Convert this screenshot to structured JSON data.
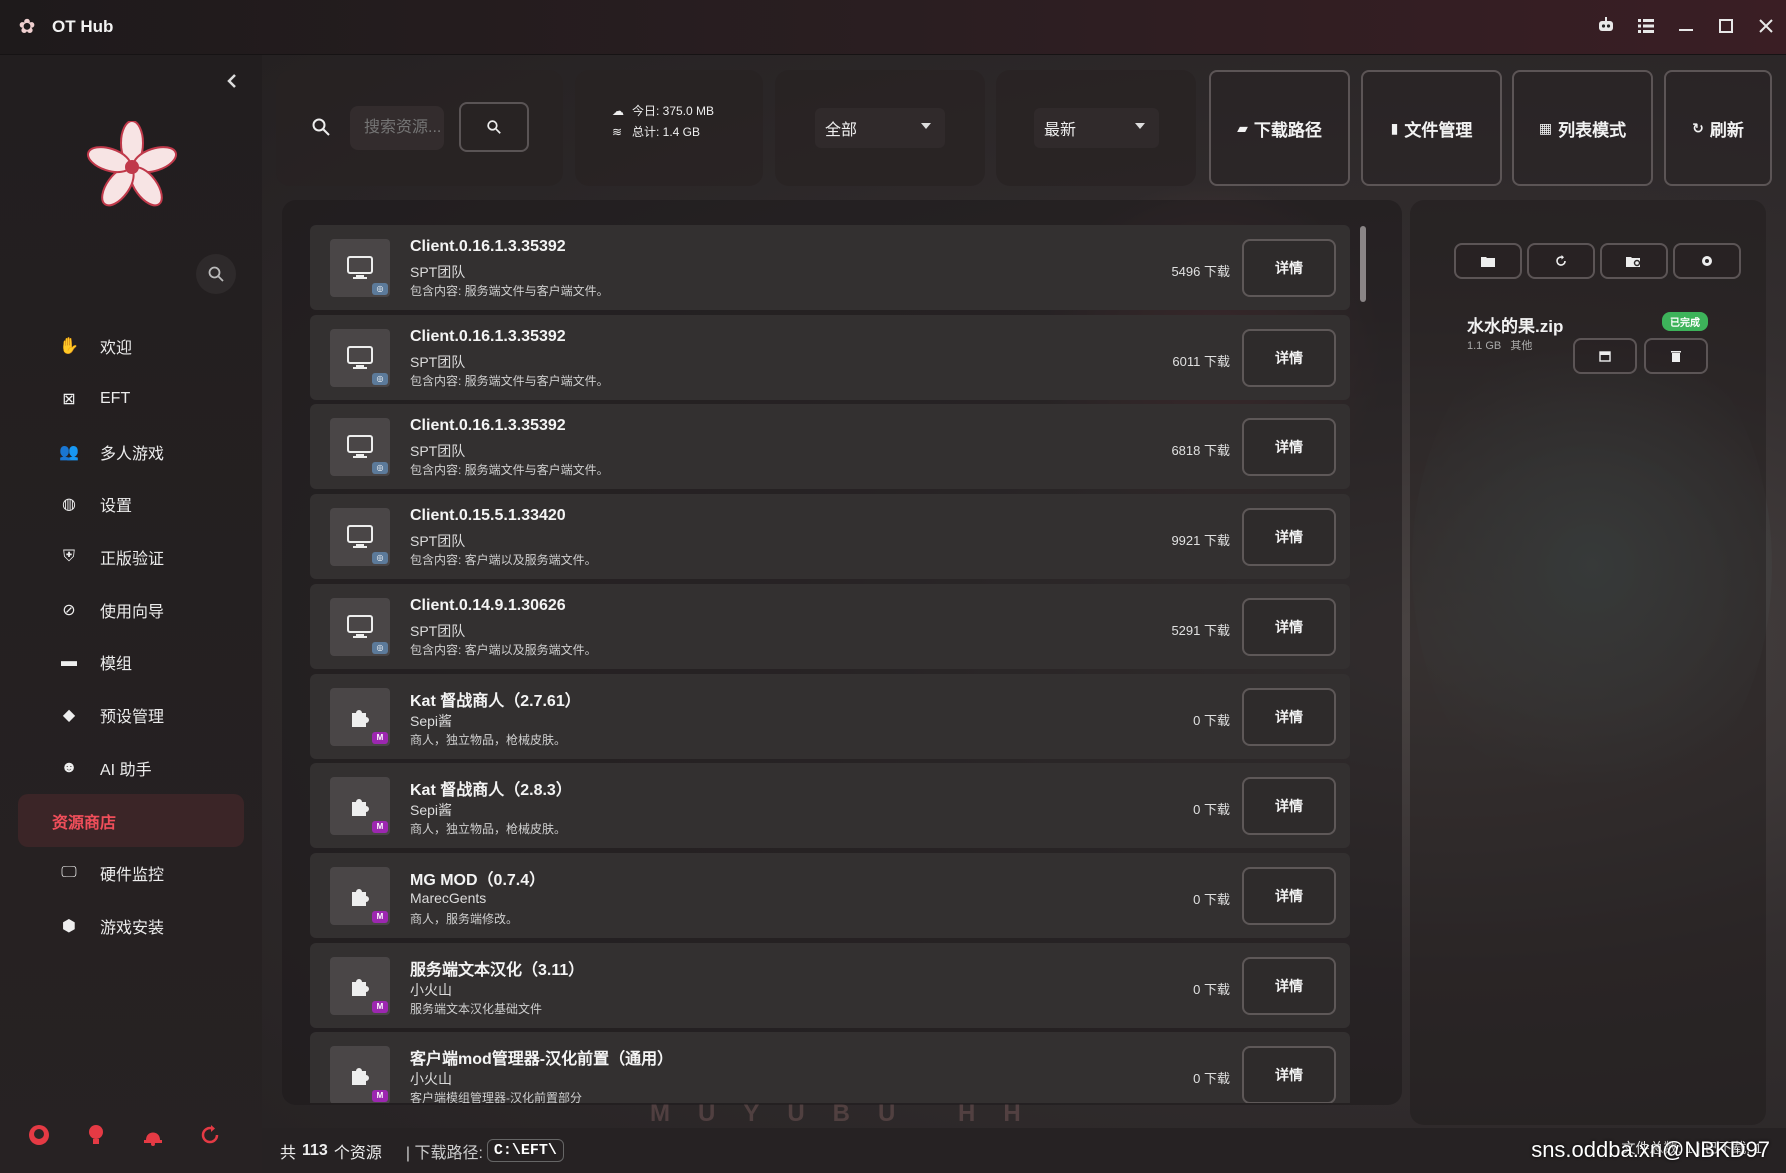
{
  "window": {
    "title": "OT Hub"
  },
  "sidebar": {
    "items": [
      {
        "label": "欢迎",
        "icon": "hand-wave-icon"
      },
      {
        "label": "EFT",
        "icon": "eft-icon"
      },
      {
        "label": "多人游戏",
        "icon": "users-icon"
      },
      {
        "label": "设置",
        "icon": "palette-icon"
      },
      {
        "label": "正版验证",
        "icon": "shield-check-icon"
      },
      {
        "label": "使用向导",
        "icon": "compass-icon"
      },
      {
        "label": "模组",
        "icon": "card-icon"
      },
      {
        "label": "预设管理",
        "icon": "tag-icon"
      },
      {
        "label": "AI 助手",
        "icon": "robot-icon"
      },
      {
        "label": "资源商店",
        "icon": "",
        "active": true
      },
      {
        "label": "硬件监控",
        "icon": "monitor-icon"
      },
      {
        "label": "游戏安装",
        "icon": "box-icon"
      }
    ]
  },
  "toolbar": {
    "search_placeholder": "搜索资源...",
    "stats_today": "今日: 375.0 MB",
    "stats_total": "总计: 1.4 GB",
    "filter_value": "全部",
    "sort_value": "最新",
    "btn_download_path": "下载路径",
    "btn_file_manage": "文件管理",
    "btn_list_mode": "列表模式",
    "btn_refresh": "刷新"
  },
  "resources": [
    {
      "name": "Client.0.16.1.3.35392",
      "author": "SPT团队",
      "desc": "包含内容: 服务端文件与客户端文件。",
      "downloads": "5496 下载",
      "type": "client",
      "detail": "详情"
    },
    {
      "name": "Client.0.16.1.3.35392",
      "author": "SPT团队",
      "desc": "包含内容: 服务端文件与客户端文件。",
      "downloads": "6011 下载",
      "type": "client",
      "detail": "详情"
    },
    {
      "name": "Client.0.16.1.3.35392",
      "author": "SPT团队",
      "desc": "包含内容: 服务端文件与客户端文件。",
      "downloads": "6818 下载",
      "type": "client",
      "detail": "详情"
    },
    {
      "name": "Client.0.15.5.1.33420",
      "author": "SPT团队",
      "desc": "包含内容: 客户端以及服务端文件。",
      "downloads": "9921 下载",
      "type": "client",
      "detail": "详情"
    },
    {
      "name": "Client.0.14.9.1.30626",
      "author": "SPT团队",
      "desc": "包含内容: 客户端以及服务端文件。",
      "downloads": "5291 下载",
      "type": "client",
      "detail": "详情"
    },
    {
      "name": "Kat 督战商人（2.7.61）",
      "author": "Sepi酱",
      "desc": "商人，独立物品，枪械皮肤。",
      "downloads": "0 下载",
      "type": "mod",
      "detail": "详情"
    },
    {
      "name": "Kat 督战商人（2.8.3）",
      "author": "Sepi酱",
      "desc": "商人，独立物品，枪械皮肤。",
      "downloads": "0 下载",
      "type": "mod",
      "detail": "详情"
    },
    {
      "name": "MG MOD（0.7.4）",
      "author": "MarecGents",
      "desc": "商人，服务端修改。",
      "downloads": "0 下载",
      "type": "mod",
      "detail": "详情"
    },
    {
      "name": "服务端文本汉化（3.11）",
      "author": "小火山",
      "desc": "服务端文本汉化基础文件",
      "downloads": "0 下载",
      "type": "mod",
      "detail": "详情"
    },
    {
      "name": "客户端mod管理器-汉化前置（通用）",
      "author": "小火山",
      "desc": "客户端模组管理器-汉化前置部分",
      "downloads": "0 下载",
      "type": "mod",
      "detail": "详情"
    }
  ],
  "downloads_panel": {
    "file_name": "水水的果.zip",
    "file_size": "1.1 GB",
    "file_category": "其他",
    "status": "已完成"
  },
  "footer": {
    "prefix": "共",
    "count": "113",
    "suffix": "个资源",
    "path_label": "| 下载路径:",
    "path_value": "C:\\EFT\\",
    "right_text": "文件总数: 1 | 已下载: 1",
    "bg_letters": "MUYUBU HH"
  },
  "watermark": "sns.oddba.xn@NBKD97",
  "colors": {
    "accent": "#f04e5a",
    "success": "#3db35a",
    "mod_badge": "#9c27b0"
  }
}
